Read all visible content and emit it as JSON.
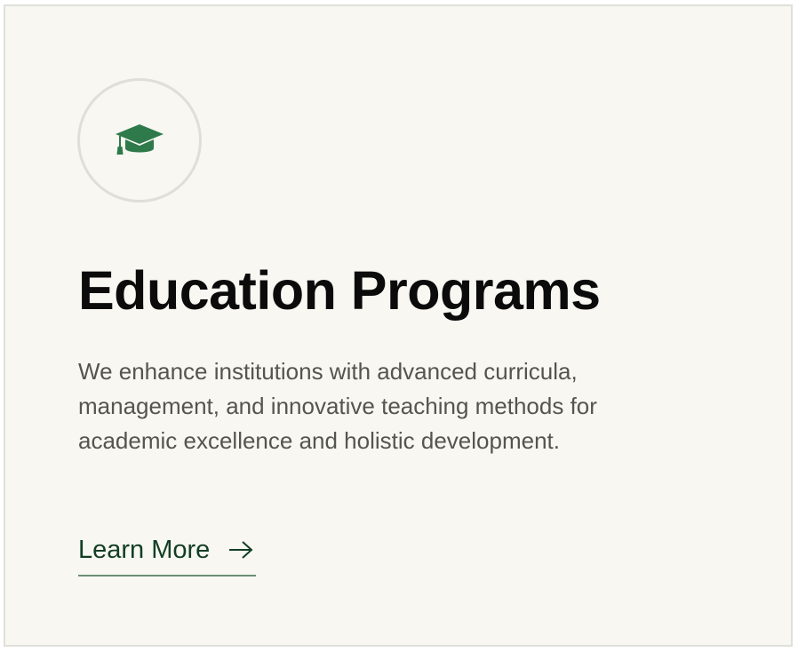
{
  "card": {
    "icon": "graduation-cap-icon",
    "title": "Education Programs",
    "description": "We enhance institutions with advanced curricula, management, and innovative teaching methods for academic excellence and holistic development.",
    "cta": {
      "label": "Learn More",
      "icon": "arrow-right-icon"
    }
  },
  "colors": {
    "card_background": "#f8f7f2",
    "card_border": "#e0e0db",
    "icon_green": "#2e7a4a",
    "title": "#0b0b0b",
    "body_text": "#55554f",
    "link_text": "#123e24",
    "link_underline": "#6c8d74"
  }
}
